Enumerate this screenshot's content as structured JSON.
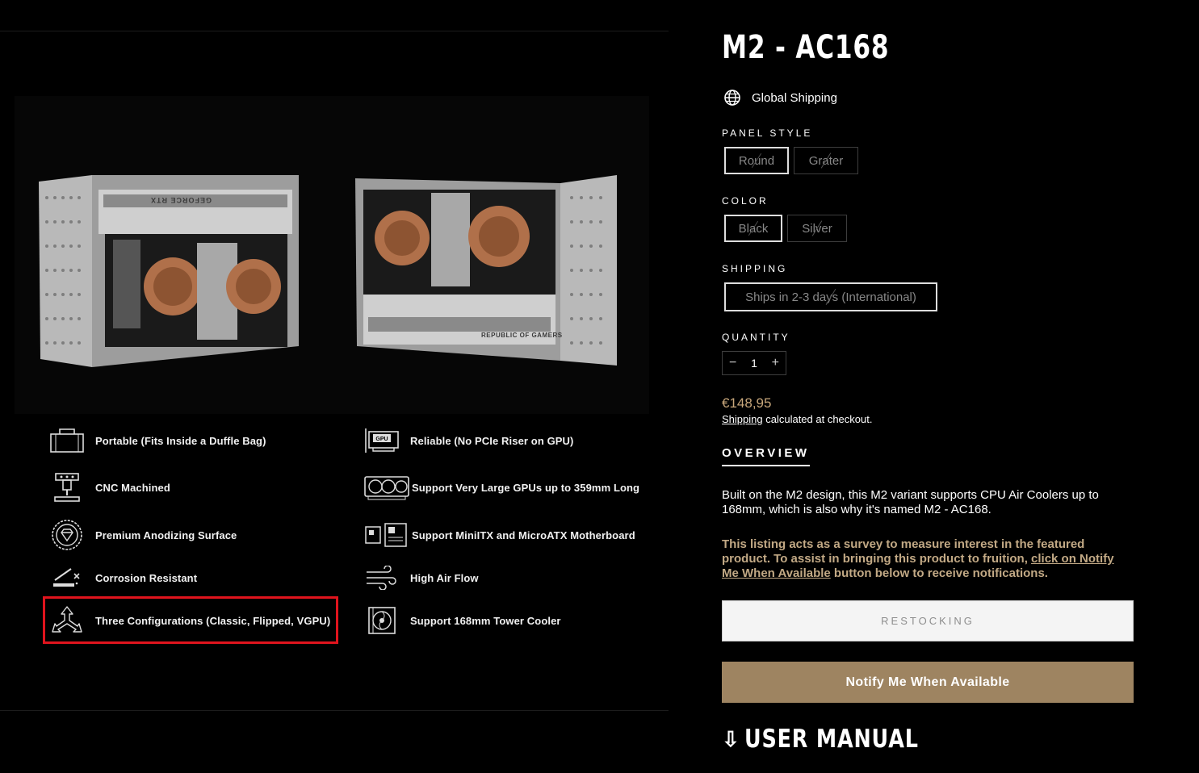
{
  "product": {
    "title": "M2 - AC168",
    "shipping_badge": "Global Shipping",
    "price": "€148,95",
    "shipping_note_link": "Shipping",
    "shipping_note_rest": " calculated at checkout."
  },
  "options": {
    "panel_style": {
      "label": "PANEL STYLE",
      "values": [
        "Round",
        "Grater"
      ],
      "selected": "Round"
    },
    "color": {
      "label": "COLOR",
      "values": [
        "Black",
        "Silver"
      ],
      "selected": "Black"
    },
    "shipping": {
      "label": "SHIPPING",
      "values": [
        "Ships in 2-3 days (International)"
      ],
      "selected": "Ships in 2-3 days (International)"
    },
    "quantity": {
      "label": "QUANTITY",
      "value": "1",
      "minus": "−",
      "plus": "+"
    }
  },
  "overview": {
    "tab": "OVERVIEW",
    "description": "Built on the M2 design, this M2 variant supports CPU Air Coolers up to 168mm, which is also why it's named M2 - AC168.",
    "survey_text": "This listing acts as a survey to measure interest in the featured product. To assist in bringing this product to fruition, ",
    "survey_link": "click on Notify Me When Available",
    "survey_tail": " button below to receive notifications."
  },
  "buttons": {
    "restocking": "RESTOCKING",
    "notify": "Notify Me When Available"
  },
  "manual": {
    "arrow": "⇩",
    "label": "USER MANUAL"
  },
  "hero": {
    "gpu_brand": "GEFORCE RTX",
    "rog_text": "REPUBLIC OF GAMERS"
  },
  "features": {
    "left": [
      "Portable (Fits Inside a Duffle Bag)",
      "CNC Machined",
      "Premium Anodizing Surface",
      "Corrosion Resistant",
      "Three Configurations (Classic, Flipped, VGPU)"
    ],
    "right": [
      "Reliable (No PCIe Riser on GPU)",
      "Support Very Large GPUs up to 359mm Long",
      "Support MiniITX and MicroATX Motherboard",
      "High Air Flow",
      "Support 168mm Tower Cooler"
    ],
    "gpu_icon_text": "GPU"
  },
  "colors": {
    "accent_gold": "#9e8461",
    "price_gold": "#c8a77b",
    "highlight_red": "#e0141d",
    "background": "#000000"
  }
}
